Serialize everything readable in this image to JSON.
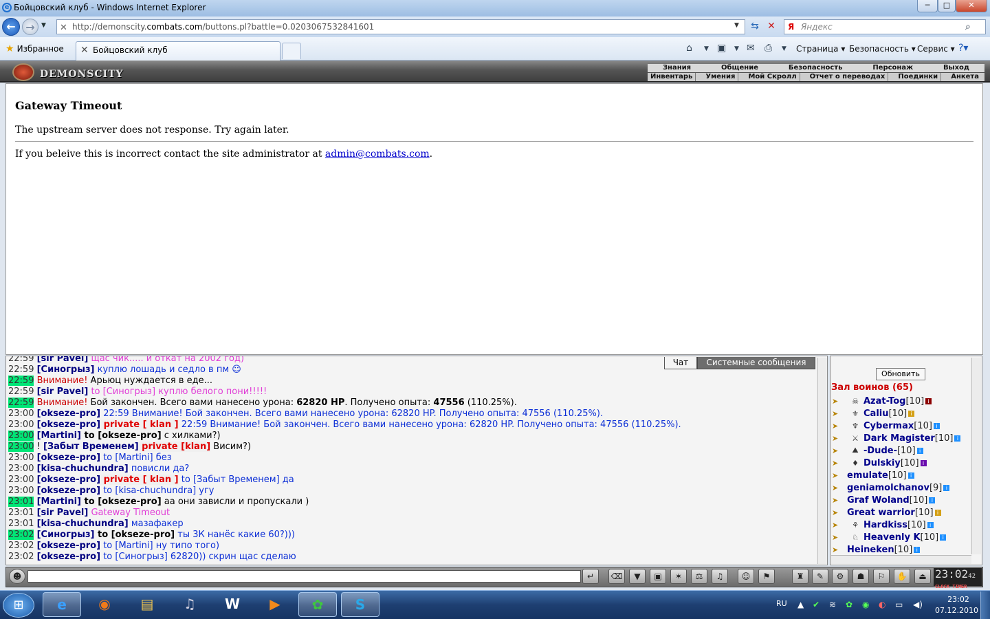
{
  "window": {
    "title": "Бойцовский клуб - Windows Internet Explorer",
    "minimize": "─",
    "maximize": "□",
    "close": "✕"
  },
  "address": {
    "url_prefix": "http://demonscity.",
    "url_domain": "combats.com",
    "url_suffix": "/buttons.pl?battle=0.0203067532841601",
    "search_placeholder": "Яндекс",
    "search_logo": "Я"
  },
  "favorites": {
    "label": "Избранное",
    "tab_title": "Бойцовский клуб"
  },
  "commands": {
    "page": "Страница",
    "safety": "Безопасность",
    "service": "Сервис"
  },
  "game": {
    "logo": "DEMONSCITY",
    "menu_top": [
      "Знания",
      "Общение",
      "Безопасность",
      "Персонаж",
      "Выход"
    ],
    "menu_bottom": [
      "Инвентарь",
      "Умения",
      "Мой Скролл",
      "Отчет о переводах",
      "Поединки",
      "Анкета"
    ]
  },
  "content": {
    "heading": "Gateway Timeout",
    "message": "The upstream server does not response. Try again later.",
    "contact_text": "If you beleive this is incorrect contact the site administrator at ",
    "contact_email": "admin@combats.com",
    "contact_end": "."
  },
  "chat": {
    "tab_chat": "Чат",
    "tab_system": "Системные сообщения",
    "lines": [
      {
        "time": "22:59",
        "hl": false,
        "parts": [
          [
            "nick",
            "[sir Pavel]"
          ],
          [
            "pm",
            " щас чик..... и откат на 2002 год)"
          ]
        ]
      },
      {
        "time": "22:59",
        "hl": false,
        "parts": [
          [
            "nick",
            "[Синогрыз]"
          ],
          [
            "bl",
            " куплю лошадь и седло в пм ☺"
          ]
        ]
      },
      {
        "time": "22:59",
        "hl": true,
        "parts": [
          [
            "warn",
            " Внимание!"
          ],
          [
            "plain",
            " Арьюц нуждается в еде..."
          ]
        ]
      },
      {
        "time": "22:59",
        "hl": false,
        "parts": [
          [
            "nick",
            "[sir Pavel]"
          ],
          [
            "pm",
            " to [Синогрыз] куплю белого пони!!!!!"
          ]
        ]
      },
      {
        "time": "22:59",
        "hl": true,
        "parts": [
          [
            "warn",
            " Внимание!"
          ],
          [
            "plain",
            " Бой закончен. Всего вами нанесено урона: "
          ],
          [
            "b",
            "62820 HP"
          ],
          [
            "plain",
            ". Получено опыта: "
          ],
          [
            "b",
            "47556"
          ],
          [
            "plain",
            " (110.25%)."
          ]
        ]
      },
      {
        "time": "23:00",
        "hl": false,
        "parts": [
          [
            "nick",
            "[okseze-pro]"
          ],
          [
            "bl",
            " 22:59 Внимание! Бой закончен. Всего вами нанесено урона: 62820 HP. Получено опыта: 47556 (110.25%)."
          ]
        ]
      },
      {
        "time": "23:00",
        "hl": false,
        "parts": [
          [
            "nick",
            "[okseze-pro]"
          ],
          [
            "red",
            " private [ klan ]"
          ],
          [
            "bl",
            " 22:59 Внимание! Бой закончен. Всего вами нанесено урона: 62820 HP. Получено опыта: 47556 (110.25%)."
          ]
        ]
      },
      {
        "time": "23:00",
        "hl": true,
        "parts": [
          [
            "nick",
            " [Martini]"
          ],
          [
            "b",
            " to [okseze-pro]"
          ],
          [
            "plain",
            " с хилками?)"
          ]
        ]
      },
      {
        "time": "23:00",
        "hl": true,
        "parts": [
          [
            "plain",
            "! "
          ],
          [
            "nick",
            "[Забыт Временем]"
          ],
          [
            "red",
            " private [klan]"
          ],
          [
            "plain",
            " Висим?)"
          ]
        ]
      },
      {
        "time": "23:00",
        "hl": false,
        "parts": [
          [
            "nick",
            "[okseze-pro]"
          ],
          [
            "bl",
            " to [Martini] без"
          ]
        ]
      },
      {
        "time": "23:00",
        "hl": false,
        "parts": [
          [
            "nick",
            "[kisa-chuchundra]"
          ],
          [
            "bl",
            " повисли да?"
          ]
        ]
      },
      {
        "time": "23:00",
        "hl": false,
        "parts": [
          [
            "nick",
            "[okseze-pro]"
          ],
          [
            "red",
            " private [ klan ]"
          ],
          [
            "bl",
            " to [Забыт Временем] да"
          ]
        ]
      },
      {
        "time": "23:00",
        "hl": false,
        "parts": [
          [
            "nick",
            "[okseze-pro]"
          ],
          [
            "bl",
            " to [kisa-chuchundra] угу"
          ]
        ]
      },
      {
        "time": "23:01",
        "hl": true,
        "parts": [
          [
            "nick",
            " [Martini]"
          ],
          [
            "b",
            " to [okseze-pro]"
          ],
          [
            "plain",
            " аа они зависли и пропускали )"
          ]
        ]
      },
      {
        "time": "23:01",
        "hl": false,
        "parts": [
          [
            "nick",
            "[sir Pavel]"
          ],
          [
            "pm",
            " Gateway Timeout"
          ]
        ]
      },
      {
        "time": "23:01",
        "hl": false,
        "parts": [
          [
            "nick",
            "[kisa-chuchundra]"
          ],
          [
            "bl",
            " мазафакер"
          ]
        ]
      },
      {
        "time": "23:02",
        "hl": true,
        "parts": [
          [
            "nick",
            " [Синогрыз]"
          ],
          [
            "b",
            " to [okseze-pro]"
          ],
          [
            "bl",
            " ты 3К нанёс какие 60?)))"
          ]
        ]
      },
      {
        "time": "23:02",
        "hl": false,
        "parts": [
          [
            "nick",
            "[okseze-pro]"
          ],
          [
            "bl",
            " to [Martini] ну типо того)"
          ]
        ]
      },
      {
        "time": "23:02",
        "hl": false,
        "parts": [
          [
            "nick",
            "[okseze-pro]"
          ],
          [
            "bl",
            " to [Синогрыз] 62820)) скрин щас сделаю"
          ]
        ]
      }
    ]
  },
  "users": {
    "refresh": "Обновить",
    "hall_title": "Зал воинов (65)",
    "list": [
      {
        "name": "Azat-Tog",
        "level": "[10]",
        "badge": "#8b0000",
        "avatar": "☠"
      },
      {
        "name": "Caliu",
        "level": "[10]",
        "badge": "#d4a017",
        "avatar": "⚜"
      },
      {
        "name": "Cybermax",
        "level": "[10]",
        "badge": "#1e90ff",
        "avatar": "♆"
      },
      {
        "name": "Dark Magister",
        "level": "[10]",
        "badge": "#1e90ff",
        "avatar": "⚔"
      },
      {
        "name": "-Dude-",
        "level": "[10]",
        "badge": "#1e90ff",
        "avatar": "⛰"
      },
      {
        "name": "Dulskiy",
        "level": "[10]",
        "badge": "#6a0dad",
        "avatar": "♦"
      },
      {
        "name": "emulate",
        "level": "[10]",
        "badge": "#1e90ff",
        "avatar": ""
      },
      {
        "name": "geniamolchanov",
        "level": "[9]",
        "badge": "#1e90ff",
        "avatar": ""
      },
      {
        "name": "Graf Woland",
        "level": "[10]",
        "badge": "#1e90ff",
        "avatar": ""
      },
      {
        "name": "Great warrior",
        "level": "[10]",
        "badge": "#d4a017",
        "avatar": ""
      },
      {
        "name": "Hardkiss",
        "level": "[10]",
        "badge": "#1e90ff",
        "avatar": "⚘"
      },
      {
        "name": "Heavenly K",
        "level": "[10]",
        "badge": "#1e90ff",
        "avatar": "♘"
      },
      {
        "name": "Heineken",
        "level": "[10]",
        "badge": "#1e90ff",
        "avatar": ""
      }
    ]
  },
  "clock": {
    "time": "23:02",
    "seconds": "42",
    "label": "CLOCK TIMER"
  },
  "taskbar": {
    "lang": "RU",
    "time": "23:02",
    "date": "07.12.2010"
  }
}
